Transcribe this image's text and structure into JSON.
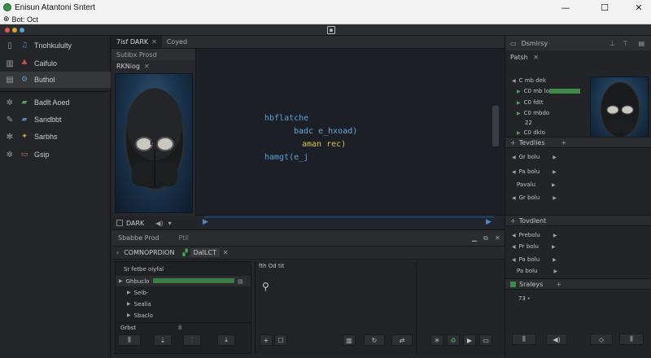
{
  "window": {
    "title": "Enisun Atantoni Sntert",
    "minimize": "—",
    "maximize": "☐",
    "close": "✕"
  },
  "menubar": {
    "icon": "⊕",
    "text": "Bot: Oct"
  },
  "sidebar": {
    "items": [
      {
        "icon": "folder-icon",
        "icon2": "music-note-icon",
        "label": "Tnohkululty"
      },
      {
        "icon": "bars-icon",
        "icon2": "bell-icon",
        "label": "Caifulo"
      },
      {
        "icon": "image-icon",
        "icon2": "gear-icon",
        "label": "Buthol"
      },
      {
        "icon": "gear-icon",
        "icon2": "chat-icon",
        "label": "Badlt Aoed"
      },
      {
        "icon": "pencil-icon",
        "icon2": "chat-icon",
        "label": "Sandbbt"
      },
      {
        "icon": "settings-icon",
        "icon2": "sparkle-icon",
        "label": "Sarbhs"
      },
      {
        "icon": "gear-icon",
        "icon2": "window-icon",
        "label": "Gsip"
      }
    ]
  },
  "editor": {
    "tabs": [
      {
        "label": "7isf DARK",
        "close": "✕"
      },
      {
        "label": "Coyed",
        "close": ""
      }
    ],
    "preview": {
      "header": "Sutibx Prosd",
      "tab_label": "RKNiog",
      "tab_close": "✕",
      "badge": "DARK",
      "mask_glyph": "m"
    },
    "code_lines": [
      {
        "text": "hbflatche",
        "color": "#5aa2d6"
      },
      {
        "text": "badc e_hxoad)",
        "color": "#6aa8d8"
      },
      {
        "text": "aman rec)",
        "color": "#d7c25a"
      },
      {
        "text": "hamgt(e_j",
        "color": "#5aa2d6"
      }
    ]
  },
  "bottom_panel": {
    "title": "Sbabbe Prod",
    "title2": "Ptil",
    "sub_label": "COMNOPRDION",
    "sub_tab": "DalLCT",
    "list_header": "Sr fetbe oiyfal",
    "list_items": [
      "Ghbuclo",
      "Selb-",
      "Sealia",
      "Sbaclo"
    ],
    "mid_header": "fth Od tit",
    "footer_left": "Grbst",
    "footer_right": "il"
  },
  "properties": {
    "title": "Dsmlrsy",
    "tab": "Patsh",
    "tab_close": "✕",
    "rows": [
      "C mb dek",
      "C0 mb lo",
      "C0 fdtt",
      "C0 mbdo",
      "22",
      "C0 dklo"
    ],
    "sections": [
      {
        "label": "Tevdlies",
        "rows": [
          "Gr bolu",
          "Pa bolu",
          "Pavalu",
          "Gr bolu"
        ]
      },
      {
        "label": "Tovdlent",
        "rows": [
          "Prebolu",
          "Pr bolu",
          "Pa bolu",
          "Pa bolu"
        ]
      },
      {
        "label": "Sraleys",
        "rows": [
          "73"
        ]
      }
    ]
  },
  "colors": {
    "accent_green": "#3c8a47",
    "accent_blue": "#2f6fb0",
    "panel_bg": "#242528"
  }
}
